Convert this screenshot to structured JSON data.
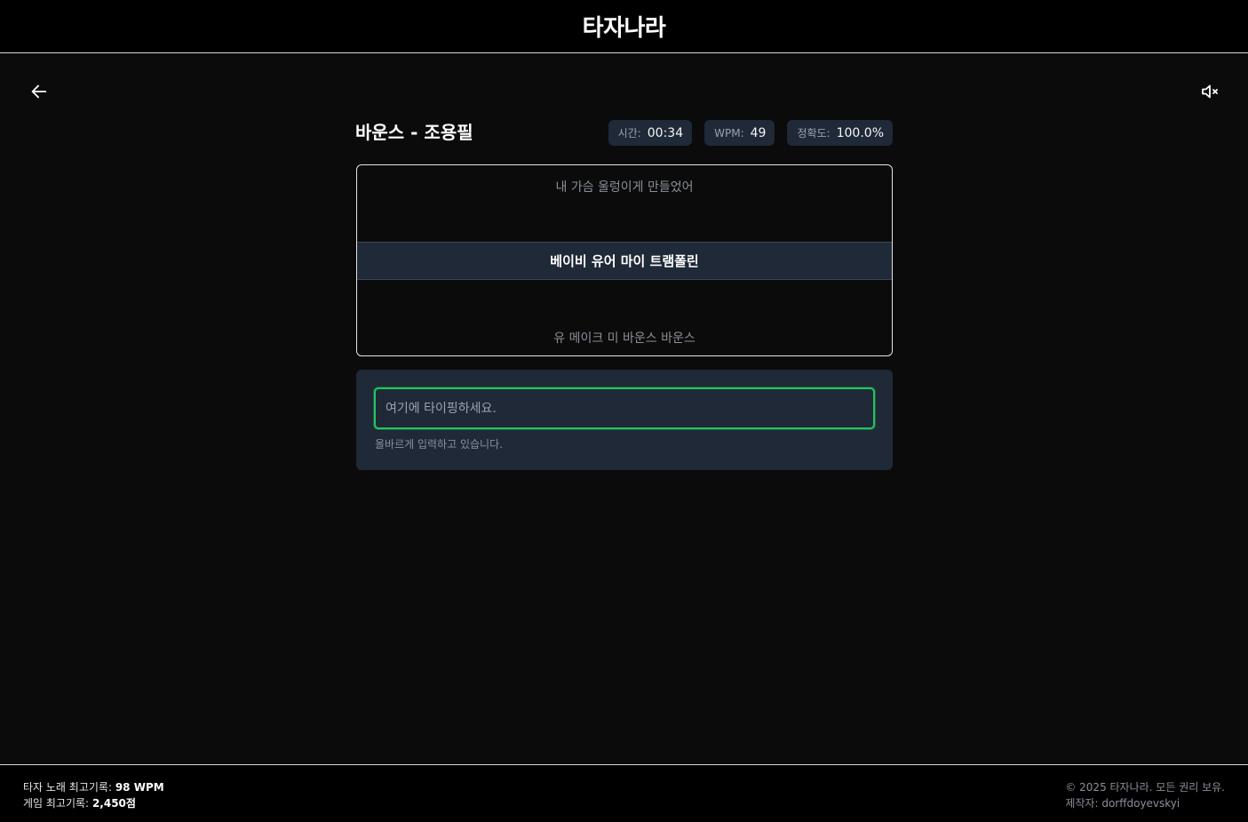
{
  "header": {
    "brand": "타자나라"
  },
  "song": {
    "title": "바운스 - 조용필"
  },
  "stats": {
    "time_label": "시간:",
    "time_value": "00:34",
    "wpm_label": "WPM:",
    "wpm_value": "49",
    "accuracy_label": "정확도:",
    "accuracy_value": "100.0%"
  },
  "lyrics": {
    "previous": "내 가슴 울렁이게 만들었어",
    "current": "베이비 유어 마이 트램폴린",
    "next": "유 메이크 미 바운스 바운스"
  },
  "typing": {
    "placeholder": "여기에 타이핑하세요.",
    "value": "",
    "status": "올바르게 입력하고 있습니다."
  },
  "footer": {
    "song_record_label": "타자 노래 최고기록:",
    "song_record_value": "98 WPM",
    "game_record_label": "게임 최고기록:",
    "game_record_value": "2,450점",
    "copyright": "© 2025 타자나라. 모든 권리 보유.",
    "creator": "제작자: dorffdoyevskyi"
  },
  "icons": {
    "back": "arrow-left-icon",
    "mute": "volume-muted-icon"
  },
  "colors": {
    "accent_green": "#22c55e",
    "panel": "#1f2937",
    "background": "#0b0b0b"
  }
}
